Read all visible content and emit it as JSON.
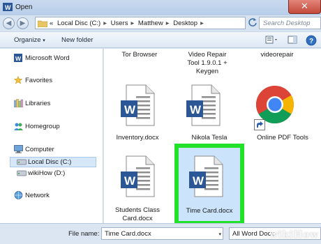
{
  "window": {
    "title": "Open",
    "close_glyph": "✕"
  },
  "address": {
    "back_glyph": "◀",
    "forward_glyph": "▶",
    "path_prefix": "«",
    "segments": [
      "Local Disc (C:)",
      "Users",
      "Matthew",
      "Desktop"
    ],
    "separator": "▸",
    "search_placeholder": "Search Desktop"
  },
  "toolbar": {
    "organize": "Organize",
    "organize_arrow": "▾",
    "new_folder": "New folder"
  },
  "nav": {
    "items": [
      {
        "label": "Microsoft Word",
        "icon": "word-icon"
      },
      {
        "label": "Favorites",
        "icon": "star-icon"
      },
      {
        "label": "Libraries",
        "icon": "libraries-icon"
      },
      {
        "label": "Homegroup",
        "icon": "homegroup-icon"
      },
      {
        "label": "Computer",
        "icon": "computer-icon"
      },
      {
        "label": "Local Disc (C:)",
        "icon": "drive-icon"
      },
      {
        "label": "wikiHow (D:)",
        "icon": "drive-icon"
      },
      {
        "label": "Network",
        "icon": "network-icon"
      }
    ]
  },
  "files": {
    "top_row": [
      "Tor Browser",
      "Video Repair\nTool 1.9.0.1 +\nKeygen",
      "videorepair"
    ],
    "inventory": "Inventory.docx",
    "nikola": "Nikola Tesla",
    "online_pdf": "Online PDF Tools",
    "students": "Students Class\nCard.docx",
    "time_card": "Time Card.docx"
  },
  "bottom": {
    "file_name_label": "File name:",
    "file_name_value": "Time Card.docx",
    "file_type_value": "All Word Docu"
  },
  "colors": {
    "highlight": "#22e12a",
    "word_blue": "#2b5797",
    "selection": "#cce4fb"
  },
  "watermark": "wikiHow"
}
